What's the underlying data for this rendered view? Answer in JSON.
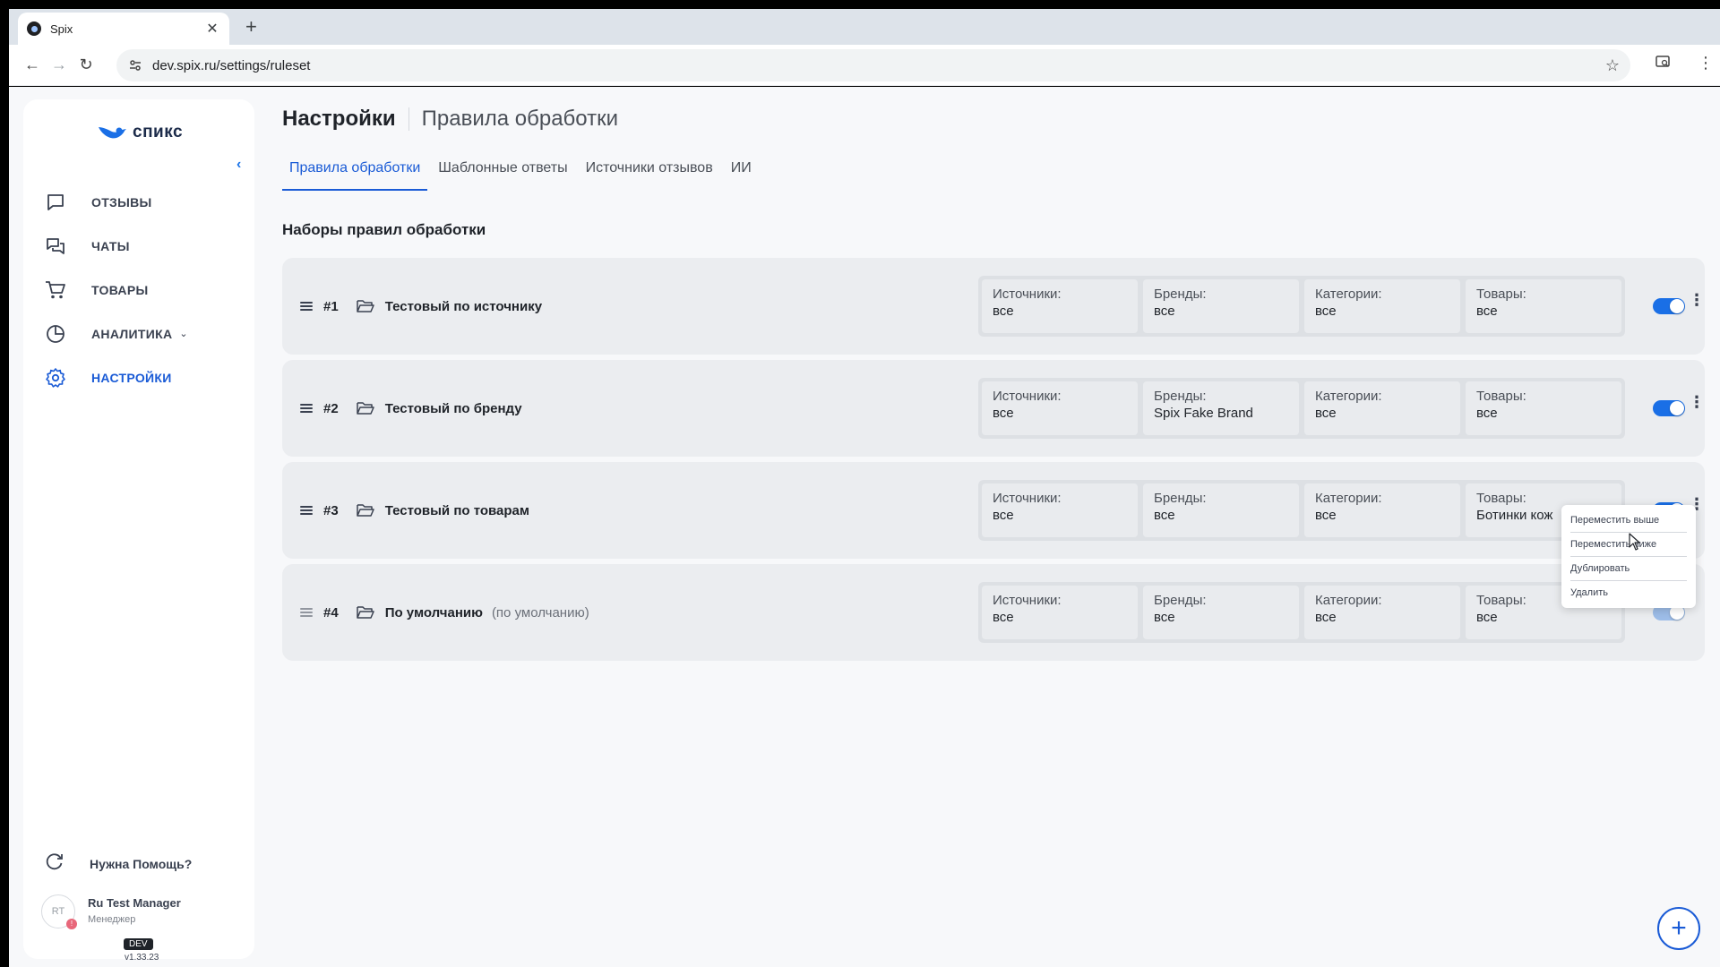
{
  "browser": {
    "tab_title": "Spix",
    "url": "dev.spix.ru/settings/ruleset"
  },
  "sidebar": {
    "logo_text": "спикс",
    "items": [
      {
        "label": "ОТЗЫВЫ",
        "icon": "message-square-icon"
      },
      {
        "label": "ЧАТЫ",
        "icon": "chats-icon"
      },
      {
        "label": "ТОВАРЫ",
        "icon": "cart-icon"
      },
      {
        "label": "АНАЛИТИКА",
        "icon": "pie-chart-icon"
      },
      {
        "label": "НАСТРОЙКИ",
        "icon": "gear-icon",
        "active": true
      }
    ],
    "help_label": "Нужна Помощь?",
    "user": {
      "initials": "RT",
      "name": "Ru Test Manager",
      "role": "Менеджер",
      "badge": "!"
    },
    "env_badge": "DEV",
    "version": "v1.33.23"
  },
  "header": {
    "title": "Настройки",
    "subtitle": "Правила обработки"
  },
  "tabs": [
    {
      "label": "Правила обработки",
      "active": true
    },
    {
      "label": "Шаблонные ответы"
    },
    {
      "label": "Источники отзывов"
    },
    {
      "label": "ИИ"
    }
  ],
  "section_title": "Наборы правил обработки",
  "rules": [
    {
      "num": "#1",
      "name": "Тестовый по источнику",
      "note": "",
      "filters": [
        {
          "label": "Источники:",
          "value": "все"
        },
        {
          "label": "Бренды:",
          "value": "все"
        },
        {
          "label": "Категории:",
          "value": "все"
        },
        {
          "label": "Товары:",
          "value": "все"
        }
      ],
      "enabled": true
    },
    {
      "num": "#2",
      "name": "Тестовый по бренду",
      "note": "",
      "filters": [
        {
          "label": "Источники:",
          "value": "все"
        },
        {
          "label": "Бренды:",
          "value": "Spix Fake Brand"
        },
        {
          "label": "Категории:",
          "value": "все"
        },
        {
          "label": "Товары:",
          "value": "все"
        }
      ],
      "enabled": true
    },
    {
      "num": "#3",
      "name": "Тестовый по товарам",
      "note": "",
      "filters": [
        {
          "label": "Источники:",
          "value": "все"
        },
        {
          "label": "Бренды:",
          "value": "все"
        },
        {
          "label": "Категории:",
          "value": "все"
        },
        {
          "label": "Товары:",
          "value": "Ботинки кож"
        }
      ],
      "enabled": true
    },
    {
      "num": "#4",
      "name": "По умолчанию",
      "note": "(по умолчанию)",
      "filters": [
        {
          "label": "Источники:",
          "value": "все"
        },
        {
          "label": "Бренды:",
          "value": "все"
        },
        {
          "label": "Категории:",
          "value": "все"
        },
        {
          "label": "Товары:",
          "value": "все"
        }
      ],
      "enabled": true,
      "toggle_disabled": true
    }
  ],
  "context_menu": {
    "items": [
      "Переместить выше",
      "Переместить ниже",
      "Дублировать",
      "Удалить"
    ]
  },
  "colors": {
    "accent": "#1a5bd6",
    "toggle_on": "#1a6fe6",
    "toggle_disabled": "#9dbde8"
  }
}
